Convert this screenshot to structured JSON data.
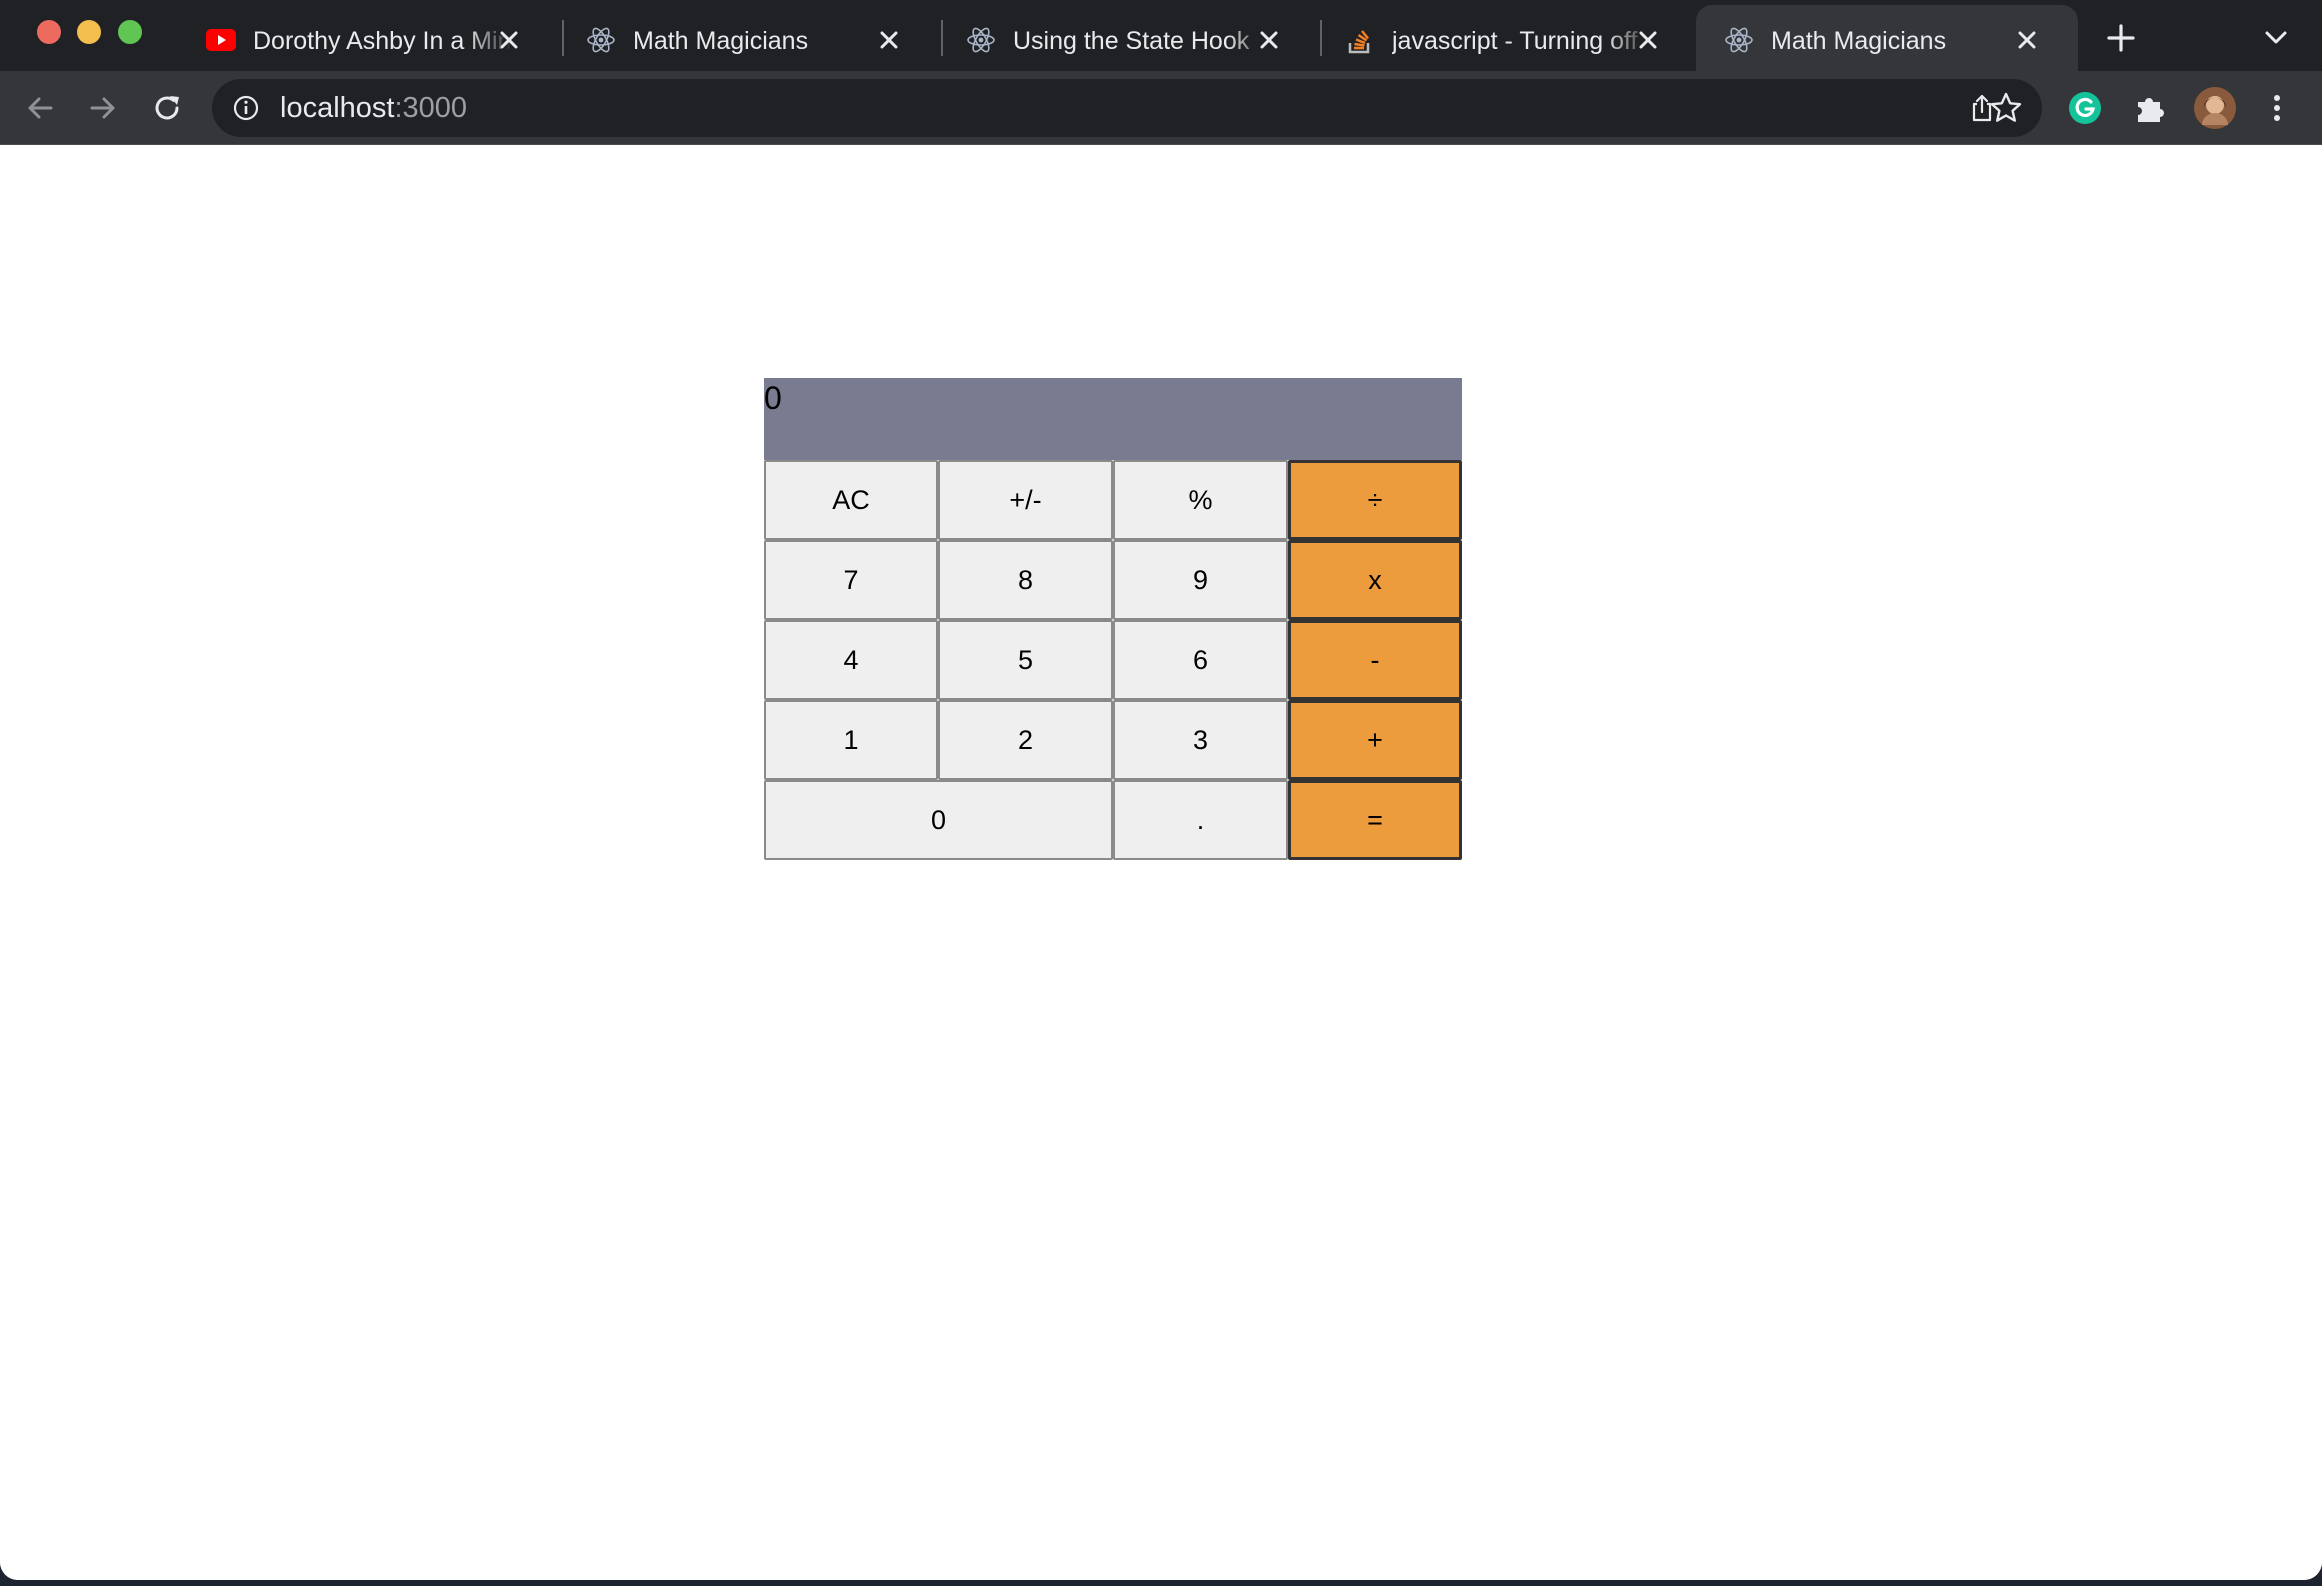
{
  "browser": {
    "tabs": [
      {
        "title": "Dorothy Ashby In a Minute",
        "favicon": "youtube-icon",
        "active": false
      },
      {
        "title": "Math Magicians",
        "favicon": "react-icon",
        "active": false
      },
      {
        "title": "Using the State Hook",
        "favicon": "react-icon",
        "active": false
      },
      {
        "title": "javascript - Turning off",
        "favicon": "stackoverflow-icon",
        "active": false
      },
      {
        "title": "Math Magicians",
        "favicon": "react-icon",
        "active": true
      }
    ],
    "address": {
      "host": "localhost",
      "port": ":3000"
    },
    "colors": {
      "frame": "#202124",
      "toolbar": "#35363a",
      "omnibox": "#202124",
      "text": "#e8eaed"
    }
  },
  "calculator": {
    "display": "0",
    "keys": {
      "ac": "AC",
      "sign": "+/-",
      "percent": "%",
      "divide": "÷",
      "seven": "7",
      "eight": "8",
      "nine": "9",
      "multiply": "x",
      "four": "4",
      "five": "5",
      "six": "6",
      "minus": "-",
      "one": "1",
      "two": "2",
      "three": "3",
      "plus": "+",
      "zero": "0",
      "dot": ".",
      "equals": "="
    },
    "colors": {
      "display": "#797c90",
      "key": "#efefef",
      "operator": "#ec9c3c"
    }
  }
}
